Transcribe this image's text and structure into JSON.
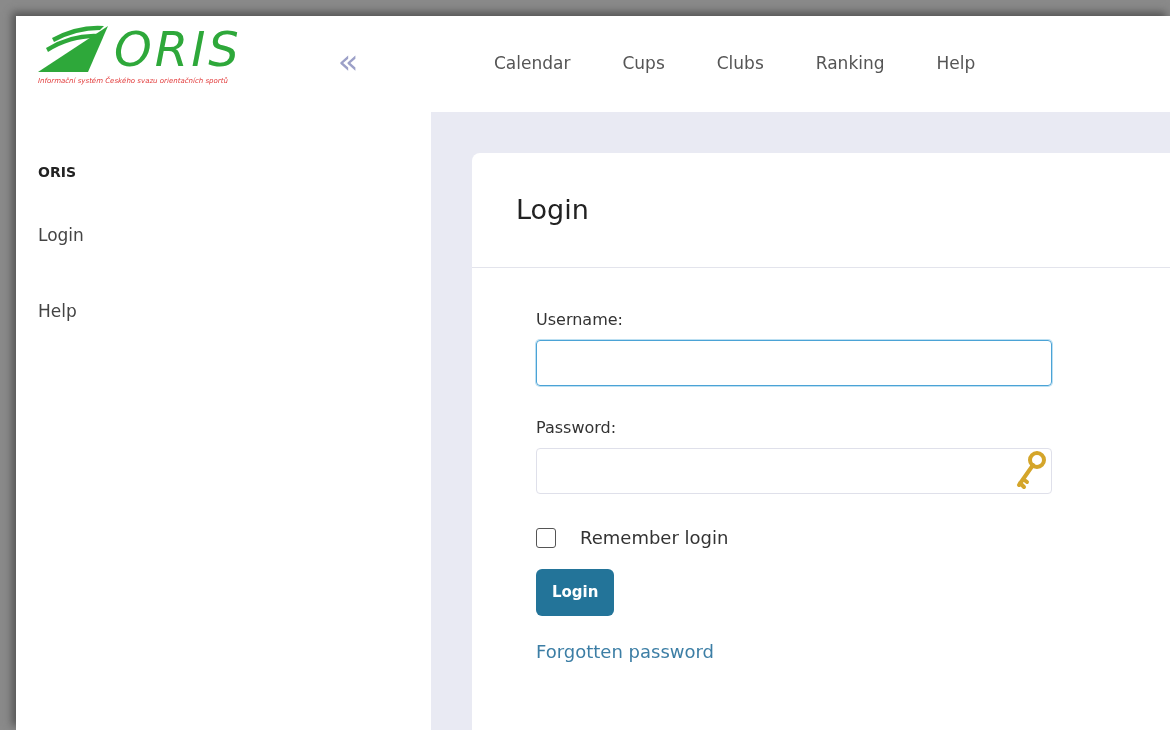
{
  "logo": {
    "name": "ORIS",
    "tagline": "Informační systém Českého svazu orientačních sportů"
  },
  "collapse": "«",
  "topnav": [
    {
      "label": "Calendar"
    },
    {
      "label": "Cups"
    },
    {
      "label": "Clubs"
    },
    {
      "label": "Ranking"
    },
    {
      "label": "Help"
    }
  ],
  "sidebar": {
    "heading": "ORIS",
    "items": [
      {
        "label": "Login"
      },
      {
        "label": "Help"
      }
    ]
  },
  "card": {
    "title": "Login",
    "fields": [
      {
        "label": "Username:",
        "kind": "text",
        "focused": true
      },
      {
        "label": "Password:",
        "kind": "password",
        "focused": false
      }
    ],
    "remember": {
      "label": "Remember login",
      "checked": false
    },
    "submit": "Login",
    "forgot": "Forgotten password"
  }
}
